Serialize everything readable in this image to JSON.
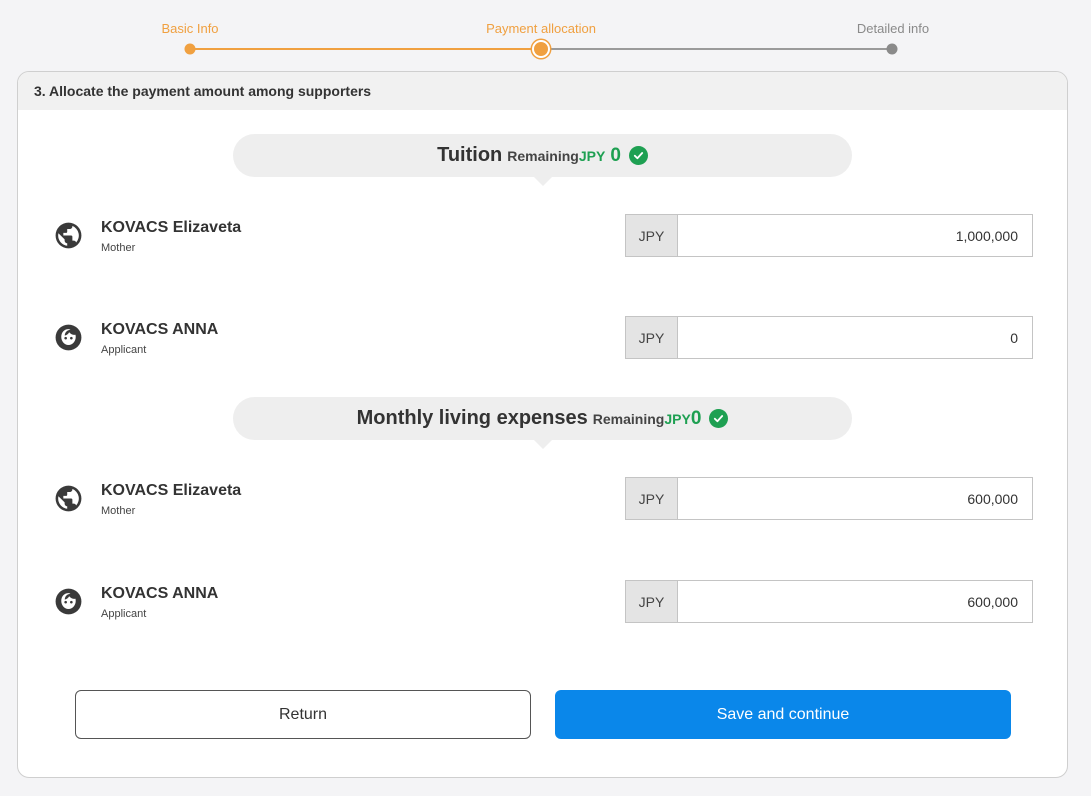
{
  "stepper": {
    "steps": [
      {
        "label": "Basic Info",
        "state": "done"
      },
      {
        "label": "Payment allocation",
        "state": "active"
      },
      {
        "label": "Detailed info",
        "state": "todo"
      }
    ]
  },
  "card": {
    "header": "3. Allocate the payment amount among supporters"
  },
  "sections": [
    {
      "title": "Tuition",
      "remaining_label": "Remaining",
      "currency": "JPY",
      "remaining_value": "0",
      "status_icon": "check-circle-icon",
      "rows": [
        {
          "name": "KOVACS Elizaveta",
          "role": "Mother",
          "icon": "globe-icon",
          "currency": "JPY",
          "amount": "1,000,000"
        },
        {
          "name": "KOVACS ANNA",
          "role": "Applicant",
          "icon": "face-icon",
          "currency": "JPY",
          "amount": "0"
        }
      ]
    },
    {
      "title": "Monthly living expenses",
      "remaining_label": "Remaining",
      "currency": "JPY",
      "remaining_value": "0",
      "status_icon": "check-circle-icon",
      "rows": [
        {
          "name": "KOVACS Elizaveta",
          "role": "Mother",
          "icon": "globe-icon",
          "currency": "JPY",
          "amount": "600,000"
        },
        {
          "name": "KOVACS ANNA",
          "role": "Applicant",
          "icon": "face-icon",
          "currency": "JPY",
          "amount": "600,000"
        }
      ]
    }
  ],
  "buttons": {
    "return_label": "Return",
    "save_label": "Save and continue"
  },
  "colors": {
    "accent": "#f0a040",
    "success": "#1ea052",
    "primary": "#0a87ea"
  }
}
